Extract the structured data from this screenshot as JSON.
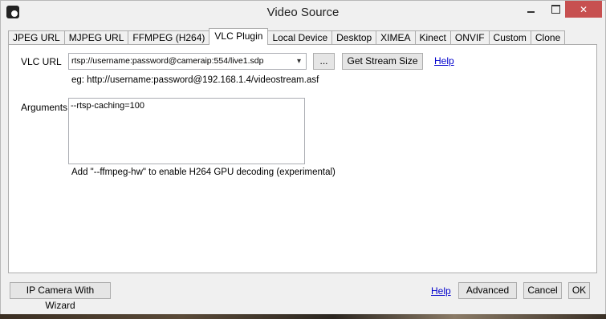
{
  "window": {
    "title": "Video Source",
    "close_glyph": "✕"
  },
  "tabs": [
    {
      "label": "JPEG URL",
      "active": false
    },
    {
      "label": "MJPEG URL",
      "active": false
    },
    {
      "label": "FFMPEG (H264)",
      "active": false
    },
    {
      "label": "VLC Plugin",
      "active": true
    },
    {
      "label": "Local Device",
      "active": false
    },
    {
      "label": "Desktop",
      "active": false
    },
    {
      "label": "XIMEA",
      "active": false
    },
    {
      "label": "Kinect",
      "active": false
    },
    {
      "label": "ONVIF",
      "active": false
    },
    {
      "label": "Custom",
      "active": false
    },
    {
      "label": "Clone",
      "active": false
    }
  ],
  "vlc": {
    "url_label": "VLC URL",
    "url_value": "rtsp://username:password@cameraip:554/live1.sdp",
    "browse_label": "...",
    "get_size_label": "Get Stream Size",
    "help_label": "Help",
    "example": "eg: http://username:password@192.168.1.4/videostream.asf",
    "arguments_label": "Arguments",
    "arguments_value": "--rtsp-caching=100",
    "hint": "Add \"--ffmpeg-hw\" to enable H264 GPU decoding (experimental)"
  },
  "footer": {
    "wizard_label": "IP Camera With Wizard",
    "help_label": "Help",
    "advanced_label": "Advanced",
    "cancel_label": "Cancel",
    "ok_label": "OK"
  },
  "icons": {
    "combo_arrow": "▾"
  }
}
